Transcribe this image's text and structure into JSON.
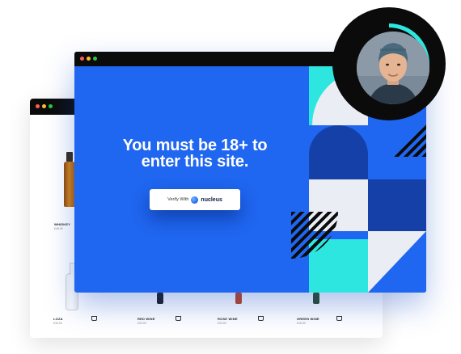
{
  "shop": {
    "products": [
      {
        "name": "WHISKEY",
        "price": "£45.00"
      },
      {
        "name": "LOZA",
        "price": "£30.00"
      },
      {
        "name": "RED WINE",
        "price": "£20.00"
      },
      {
        "name": "ROSE WINE",
        "price": "£20.00"
      },
      {
        "name": "GREEN WINE",
        "price": "£15.00"
      }
    ]
  },
  "age_gate": {
    "headline_line1": "You must be 18+ to",
    "headline_line2": "enter this site.",
    "verify_label": "Verify With",
    "brand_name": "nucleus"
  },
  "avatar": {
    "progress": 0.5
  },
  "colors": {
    "primary_blue": "#1f66f0",
    "navy": "#1540a8",
    "cyan": "#2ee6e0",
    "light_grey": "#eaedf3",
    "black": "#0b0b0b"
  }
}
